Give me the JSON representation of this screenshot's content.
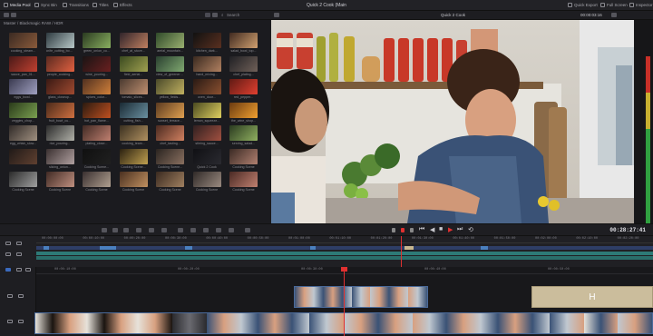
{
  "topbar": {
    "items": [
      {
        "label": "Media Pool",
        "active": true
      },
      {
        "label": "Sync Bin",
        "active": false
      },
      {
        "label": "Transitions",
        "active": false
      },
      {
        "label": "Titles",
        "active": false
      },
      {
        "label": "Effects",
        "active": false
      }
    ],
    "project_title": "Quick 2 Cook (Main",
    "right_items": [
      {
        "label": "Quick Export"
      },
      {
        "label": "Full Screen"
      },
      {
        "label": "Inspector"
      }
    ]
  },
  "bar2": {
    "search_label": "Search",
    "viewer_title": "Quick 2 Cook",
    "timecode": "00:00:03:16"
  },
  "media_pool": {
    "path": "Master / Blackmagic RAW / HDR",
    "clips": [
      {
        "label": "cooking_steam...",
        "colors": [
          "#3a2a22",
          "#8a5a3a"
        ]
      },
      {
        "label": "knife_cutting_board...",
        "colors": [
          "#2e3a40",
          "#b8c8c8"
        ]
      },
      {
        "label": "green_onion_cu...",
        "colors": [
          "#2a3a20",
          "#8ab060"
        ]
      },
      {
        "label": "chef_at_stove...",
        "colors": [
          "#30242a",
          "#c08060"
        ]
      },
      {
        "label": "aerial_mountain...",
        "colors": [
          "#304a2a",
          "#9ab070"
        ]
      },
      {
        "label": "kitchen_dark...",
        "colors": [
          "#111",
          "#5a3020"
        ]
      },
      {
        "label": "salad_bowl_top...",
        "colors": [
          "#402a20",
          "#d0a070"
        ]
      },
      {
        "label": "sauce_pan_01...",
        "colors": [
          "#4a1a18",
          "#c04030"
        ]
      },
      {
        "label": "people_cooking...",
        "colors": [
          "#5a2a20",
          "#e06040"
        ]
      },
      {
        "label": "wine_pouring...",
        "colors": [
          "#1a1414",
          "#6a2020"
        ]
      },
      {
        "label": "field_aerial...",
        "colors": [
          "#3a4a20",
          "#a0a050"
        ]
      },
      {
        "label": "view_of_greenery...",
        "colors": [
          "#2a4030",
          "#80a870"
        ]
      },
      {
        "label": "hand_mixing...",
        "colors": [
          "#3a2a20",
          "#b08060"
        ]
      },
      {
        "label": "chef_plating...",
        "colors": [
          "#202024",
          "#706058"
        ]
      },
      {
        "label": "eggs_bowl...",
        "colors": [
          "#3a3a50",
          "#a0a0c0"
        ]
      },
      {
        "label": "glass_closeup...",
        "colors": [
          "#3a1a14",
          "#a04a30"
        ]
      },
      {
        "label": "spices_color...",
        "colors": [
          "#503020",
          "#d0803a"
        ]
      },
      {
        "label": "tomato_slices...",
        "colors": [
          "#4a3a30",
          "#c09070"
        ]
      },
      {
        "label": "yellow_fields...",
        "colors": [
          "#4a4a2a",
          "#c0b060"
        ]
      },
      {
        "label": "oven_door...",
        "colors": [
          "#2a1a14",
          "#8a5030"
        ]
      },
      {
        "label": "red_pepper...",
        "colors": [
          "#601a14",
          "#e04030"
        ]
      },
      {
        "label": "veggies_chop...",
        "colors": [
          "#2a3a1a",
          "#7aa050"
        ]
      },
      {
        "label": "fruit_bowl_cu...",
        "colors": [
          "#4a2a1a",
          "#d07040"
        ]
      },
      {
        "label": "hot_pan_flame...",
        "colors": [
          "#2a1a10",
          "#c05020"
        ]
      },
      {
        "label": "cutting_fish...",
        "colors": [
          "#1a2a34",
          "#6a90a0"
        ]
      },
      {
        "label": "sunset_terrace...",
        "colors": [
          "#5a3a20",
          "#e0a050"
        ]
      },
      {
        "label": "lemon_squeeze...",
        "colors": [
          "#4a4a20",
          "#e0d060"
        ]
      },
      {
        "label": "the_wine_shop...",
        "colors": [
          "#6a3a10",
          "#f0a030"
        ]
      },
      {
        "label": "egg_whisk_slow...",
        "colors": [
          "#302a28",
          "#a09080"
        ]
      },
      {
        "label": "rice_pouring...",
        "colors": [
          "#2a2a2a",
          "#b0b0a8"
        ]
      },
      {
        "label": "plating_close...",
        "colors": [
          "#402a24",
          "#c08070"
        ]
      },
      {
        "label": "cooking_team...",
        "colors": [
          "#3a3020",
          "#b09060"
        ]
      },
      {
        "label": "chef_tasting...",
        "colors": [
          "#4a2a20",
          "#d08060"
        ]
      },
      {
        "label": "stirring_sauce...",
        "colors": [
          "#302020",
          "#a05040"
        ]
      },
      {
        "label": "serving_salad...",
        "colors": [
          "#2a3a20",
          "#90b060"
        ]
      },
      {
        "label": "",
        "colors": [
          "#201a18",
          "#604030"
        ]
      },
      {
        "label": "slicing_onion...",
        "colors": [
          "#3a3030",
          "#b0a0a0"
        ]
      },
      {
        "label": "Cooking Scene...",
        "colors": [
          "#101010",
          "#202020"
        ]
      },
      {
        "label": "Cooking Scene...",
        "colors": [
          "#2a2010",
          "#c0a050"
        ]
      },
      {
        "label": "Cooking Scene...",
        "colors": [
          "#2a2420",
          "#8a7060"
        ]
      },
      {
        "label": "Quick 2 Cook",
        "colors": [
          "#101014",
          "#2a2a30"
        ]
      },
      {
        "label": "Cooking Scene",
        "colors": [
          "#3a2a24",
          "#b08070"
        ]
      },
      {
        "label": "Cooking Scene",
        "colors": [
          "#2a2a2a",
          "#a0a0a0"
        ]
      },
      {
        "label": "Cooking Scene",
        "colors": [
          "#402a24",
          "#c09080"
        ]
      },
      {
        "label": "Cooking Scene",
        "colors": [
          "#3a3030",
          "#b0a090"
        ]
      },
      {
        "label": "Cooking Scene",
        "colors": [
          "#4a3020",
          "#c09060"
        ]
      },
      {
        "label": "Cooking Scene",
        "colors": [
          "#3a2a20",
          "#a08060"
        ]
      },
      {
        "label": "Cooking Scene",
        "colors": [
          "#302a28",
          "#9a8a80"
        ]
      },
      {
        "label": "Cooking Scene",
        "colors": [
          "#4a2a24",
          "#c08070"
        ]
      }
    ]
  },
  "transport": {
    "timecode": "00:28:27:41"
  },
  "timeline": {
    "ruler_upper": [
      "00:00:00:00",
      "00:00:10:00",
      "00:00:20:00",
      "00:00:30:00",
      "00:00:40:00",
      "00:00:50:00",
      "00:01:00:00",
      "00:01:10:00",
      "00:01:20:00",
      "00:01:30:00",
      "00:01:40:00",
      "00:01:50:00",
      "00:02:00:00",
      "00:02:10:00",
      "00:02:20:00"
    ],
    "ruler_lower": [
      "00:00:10:00",
      "00:00:20:00",
      "00:00:30:00",
      "00:00:40:00",
      "00:00:50:00"
    ],
    "title_clip_label": "H",
    "accent_color": "#e03030"
  }
}
